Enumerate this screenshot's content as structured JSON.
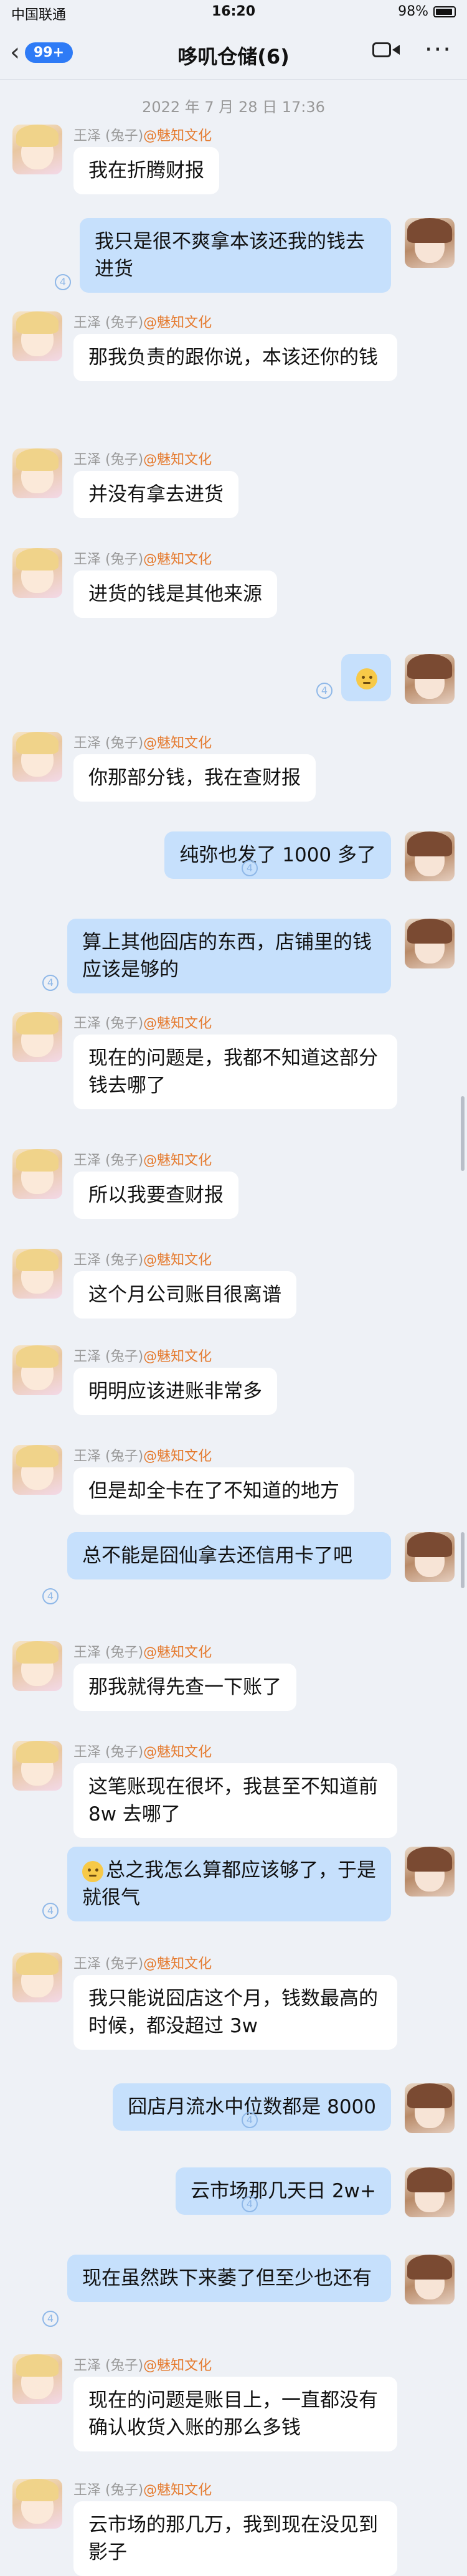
{
  "status_bar": {
    "carrier": "中国联通",
    "time": "16:20",
    "battery": "98%"
  },
  "nav": {
    "back_badge": "99+",
    "title": "哆叽仓储(6)"
  },
  "timestamp": "2022 年 7 月 28 日 17:36",
  "sender": {
    "name": "王泽 (兔子)",
    "org": "@魅知文化"
  },
  "messages": [
    {
      "side": "left",
      "text": "我在折腾财报"
    },
    {
      "side": "right",
      "text": "我只是很不爽拿本该还我的钱去进货"
    },
    {
      "side": "left",
      "text": "那我负责的跟你说，本该还你的钱"
    },
    {
      "side": "left",
      "text": "并没有拿去进货"
    },
    {
      "side": "left",
      "text": "进货的钱是其他来源"
    },
    {
      "side": "right",
      "text": "",
      "emoji": "sweat-face"
    },
    {
      "side": "left",
      "text": "你那部分钱，我在查财报"
    },
    {
      "side": "right",
      "text": "纯弥也发了 1000 多了"
    },
    {
      "side": "right",
      "text": "算上其他囧店的东西，店铺里的钱应该是够的"
    },
    {
      "side": "left",
      "text": "现在的问题是，我都不知道这部分钱去哪了"
    },
    {
      "side": "left",
      "text": "所以我要查财报"
    },
    {
      "side": "left",
      "text": "这个月公司账目很离谱"
    },
    {
      "side": "left",
      "text": "明明应该进账非常多"
    },
    {
      "side": "left",
      "text": "但是却全卡在了不知道的地方"
    },
    {
      "side": "right",
      "text": "总不能是囧仙拿去还信用卡了吧"
    },
    {
      "side": "left",
      "text": "那我就得先查一下账了"
    },
    {
      "side": "left",
      "text": "这笔账现在很坏，我甚至不知道前 8w 去哪了"
    },
    {
      "side": "right",
      "text": "总之我怎么算都应该够了，于是就很气",
      "emoji": "sweat-face"
    },
    {
      "side": "left",
      "text": "我只能说囧店这个月，钱数最高的时候，都没超过 3w"
    },
    {
      "side": "right",
      "text": "囧店月流水中位数都是 8000"
    },
    {
      "side": "right",
      "text": "云市场那几天日 2w+"
    },
    {
      "side": "right",
      "text": "现在虽然跌下来萎了但至少也还有"
    },
    {
      "side": "left",
      "text": "现在的问题是账目上，一直都没有确认收货入账的那么多钱"
    },
    {
      "side": "left",
      "text": "云市场的那几万，我到现在没见到影子"
    }
  ]
}
